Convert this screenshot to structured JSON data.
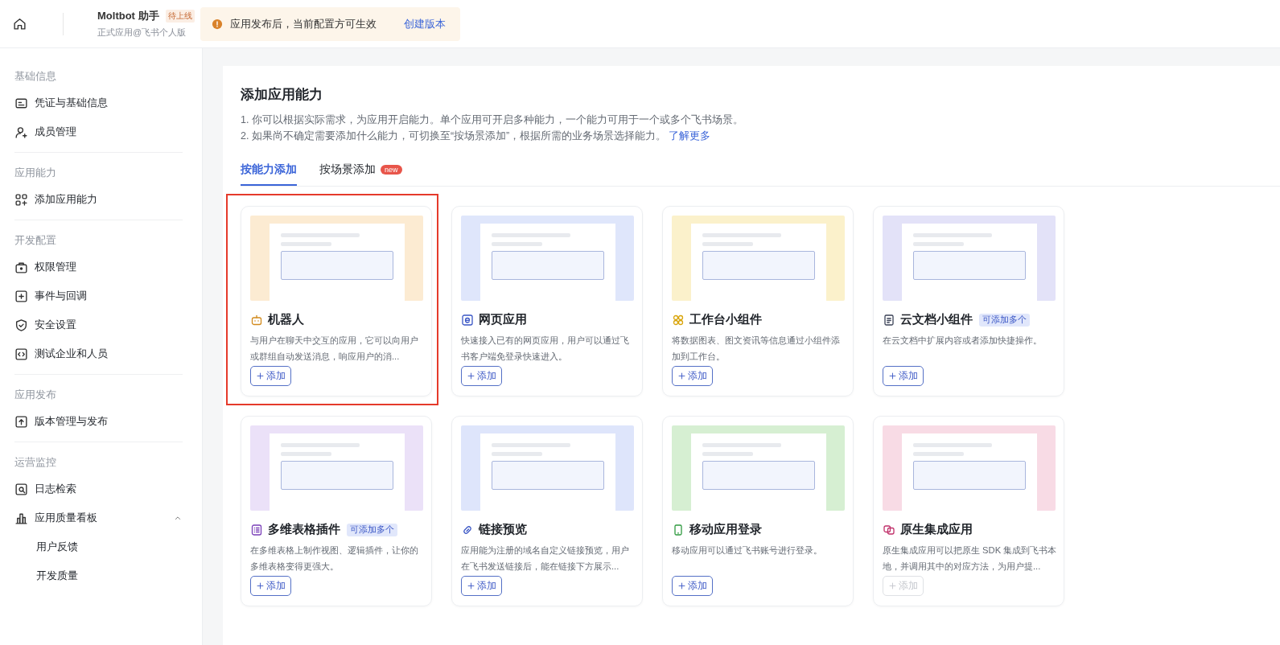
{
  "topbar": {
    "app_name": "Moltbot 助手",
    "status_badge": "待上线",
    "app_subtitle": "正式应用@飞书个人版",
    "notice": {
      "text": "应用发布后，当前配置方可生效",
      "link": "创建版本"
    }
  },
  "sidebar": {
    "groups": [
      {
        "title": "基础信息",
        "items": [
          {
            "label": "凭证与基础信息"
          },
          {
            "label": "成员管理"
          }
        ]
      },
      {
        "title": "应用能力",
        "items": [
          {
            "label": "添加应用能力"
          }
        ]
      },
      {
        "title": "开发配置",
        "items": [
          {
            "label": "权限管理"
          },
          {
            "label": "事件与回调"
          },
          {
            "label": "安全设置"
          },
          {
            "label": "测试企业和人员"
          }
        ]
      },
      {
        "title": "应用发布",
        "items": [
          {
            "label": "版本管理与发布"
          }
        ]
      },
      {
        "title": "运营监控",
        "items": [
          {
            "label": "日志检索"
          },
          {
            "label": "应用质量看板",
            "expanded": true,
            "children": [
              {
                "label": "用户反馈"
              },
              {
                "label": "开发质量"
              }
            ]
          }
        ]
      }
    ]
  },
  "main": {
    "title": "添加应用能力",
    "notes": [
      "1. 你可以根据实际需求，为应用开启能力。单个应用可开启多种能力，一个能力可用于一个或多个飞书场景。",
      "2. 如果尚不确定需要添加什么能力，可切换至“按场景添加”，根据所需的业务场景选择能力。"
    ],
    "notes_link": "了解更多",
    "tabs": [
      {
        "label": "按能力添加",
        "selected": true
      },
      {
        "label": "按场景添加",
        "selected": false,
        "badge": "new"
      }
    ],
    "cards": [
      {
        "title": "机器人",
        "description": "与用户在聊天中交互的应用，它可以向用户或群组自动发送消息，响应用户的消...",
        "color": "#fcebd2",
        "highlighted": true,
        "button": {
          "label": "添加",
          "disabled": false
        }
      },
      {
        "title": "网页应用",
        "description": "快速接入已有的网页应用，用户可以通过飞书客户端免登录快速进入。",
        "color": "#dfe6fb",
        "highlighted": false,
        "button": {
          "label": "添加",
          "disabled": false
        }
      },
      {
        "title": "工作台小组件",
        "description": "将数据图表、图文资讯等信息通过小组件添加到工作台。",
        "color": "#fbf1cb",
        "highlighted": false,
        "button": {
          "label": "添加",
          "disabled": false
        }
      },
      {
        "title": "云文档小组件",
        "tag": "可添加多个",
        "description": "在云文档中扩展内容或者添加快捷操作。",
        "color": "#e3e2f8",
        "highlighted": false,
        "button": {
          "label": "添加",
          "disabled": false
        }
      },
      {
        "title": "多维表格插件",
        "tag": "可添加多个",
        "description": "在多维表格上制作视图、逻辑插件，让你的多维表格变得更强大。",
        "color": "#ebe1f8",
        "highlighted": false,
        "button": {
          "label": "添加",
          "disabled": false
        }
      },
      {
        "title": "链接预览",
        "description": "应用能为注册的域名自定义链接预览，用户在飞书发送链接后，能在链接下方展示...",
        "color": "#dee5fb",
        "highlighted": false,
        "button": {
          "label": "添加",
          "disabled": false
        }
      },
      {
        "title": "移动应用登录",
        "description": "移动应用可以通过飞书账号进行登录。",
        "color": "#d6efd2",
        "highlighted": false,
        "button": {
          "label": "添加",
          "disabled": false
        }
      },
      {
        "title": "原生集成应用",
        "description": "原生集成应用可以把原生 SDK 集成到飞书本地，并调用其中的对应方法，为用户提...",
        "color": "#f8dbe5",
        "highlighted": false,
        "button": {
          "label": "添加",
          "disabled": true
        }
      }
    ]
  }
}
